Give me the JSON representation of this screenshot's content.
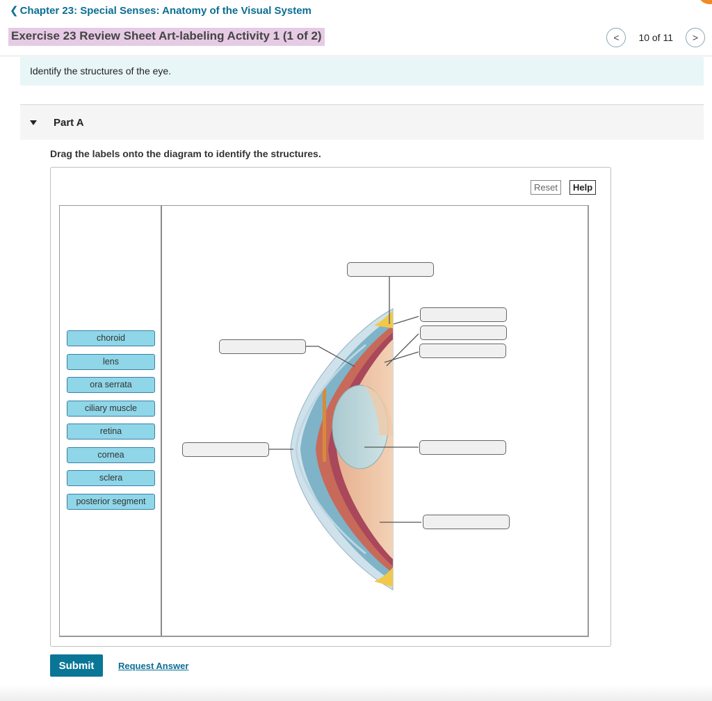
{
  "header": {
    "chapter_link": "Chapter 23: Special Senses: Anatomy of the Visual System",
    "exercise_title": "Exercise 23 Review Sheet Art-labeling Activity 1 (1 of 2)",
    "pager": {
      "count": "10 of 11",
      "prev_icon": "chevron-left-icon",
      "next_icon": "chevron-right-icon"
    }
  },
  "intro": "Identify the structures of the eye.",
  "part": {
    "label": "Part A",
    "instruction": "Drag the labels onto the diagram to identify the structures."
  },
  "toolbar": {
    "reset": "Reset",
    "help": "Help"
  },
  "labels": [
    "choroid",
    "lens",
    "ora serrata",
    "ciliary muscle",
    "retina",
    "cornea",
    "sclera",
    "posterior segment"
  ],
  "actions": {
    "submit": "Submit",
    "request_answer": "Request Answer"
  },
  "colors": {
    "accent": "#0a7696",
    "link": "#0a6e93",
    "label_chip": "#8fd6e8",
    "title_highlight": "#e6cbe5",
    "intro_bg": "#e8f6f8"
  }
}
